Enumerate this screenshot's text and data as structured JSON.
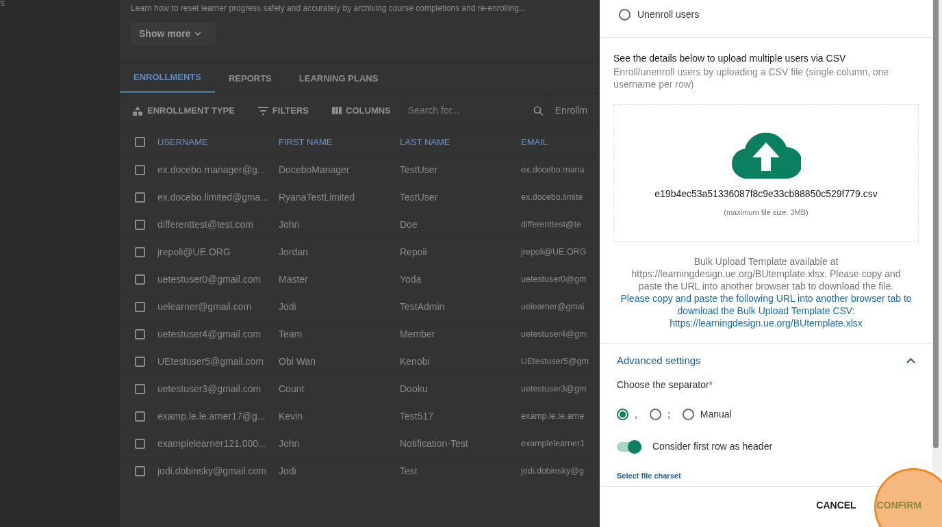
{
  "sidebar": {
    "fragment": "s"
  },
  "course": {
    "description": "Learn how to reset learner progress safely and accurately by archiving course completions and re-enrolling...",
    "show_more": "Show more"
  },
  "tabs": [
    {
      "label": "ENROLLMENTS",
      "selected": true
    },
    {
      "label": "REPORTS",
      "selected": false
    },
    {
      "label": "LEARNING PLANS",
      "selected": false
    }
  ],
  "toolbar": {
    "enrollment_type": "ENROLLMENT TYPE",
    "filters": "FILTERS",
    "columns": "COLUMNS",
    "search_placeholder": "Search for...",
    "dropdown": "Enrollm"
  },
  "table": {
    "all_checked": false,
    "columns": [
      "USERNAME",
      "FIRST NAME",
      "LAST NAME",
      "EMAIL"
    ],
    "rows": [
      {
        "checked": false,
        "cells": [
          "ex.docebo.manager@g...",
          "DoceboManager",
          "TestUser",
          "ex.docebo.mana"
        ]
      },
      {
        "checked": false,
        "cells": [
          "ex.docebo.limited@gma...",
          "RyanaTestLimited",
          "TestUser",
          "ex.docebo.limite"
        ]
      },
      {
        "checked": false,
        "cells": [
          "differenttest@test.com",
          "John",
          "Doe",
          "differenttest@te"
        ]
      },
      {
        "checked": false,
        "cells": [
          "jrepoli@UE.ORG",
          "Jordan",
          "Repoli",
          "jrepoli@UE.ORG"
        ]
      },
      {
        "checked": false,
        "cells": [
          "uetestuser0@gmail.com",
          "Master",
          "Yoda",
          "uetestuser0@gm"
        ]
      },
      {
        "checked": false,
        "cells": [
          "uelearner@gmail.com",
          "Jodi",
          "TestAdmin",
          "uelearner@gmai"
        ]
      },
      {
        "checked": false,
        "cells": [
          "uetestuser4@gmail.com",
          "Team",
          "Member",
          "uetestuser4@gm"
        ]
      },
      {
        "checked": false,
        "cells": [
          "UEtestuser5@gmail.com",
          "Obi Wan",
          "Kenobi",
          "UEtestuser5@gm"
        ]
      },
      {
        "checked": false,
        "cells": [
          "uetestuser3@gmail.com",
          "Count",
          "Dooku",
          "uetestuser3@gm"
        ]
      },
      {
        "checked": false,
        "cells": [
          "examp.le.le.arner17@g...",
          "Kevin",
          "Test517",
          "examp.le.le.arne"
        ]
      },
      {
        "checked": false,
        "cells": [
          "examplelearner121.000...",
          "John",
          "Notification-Test",
          "examplelearner1"
        ]
      },
      {
        "checked": false,
        "cells": [
          "jodi.dobinsky@gmail.com",
          "Jodi",
          "Test",
          "jodi.dobinsky@g"
        ]
      }
    ]
  },
  "drawer": {
    "unenroll": {
      "label": "Unenroll users",
      "selected": false
    },
    "csv_title": "See the details below to upload multiple users via CSV",
    "csv_description": "Enroll/unenroll users by uploading a CSV file (single column, one username per row)",
    "file_name": "e19b4ec53a51336087f8c9e33cb88850c529f779.csv",
    "max_size": "(maximum file size: 3MB)",
    "template_note": "Bulk Upload Template available at https://learningdesign.ue.org/BUtemplate.xlsx. Please copy and paste the URL into another browser tab to download the file.",
    "template_link": "Please copy and paste the following URL into another browser tab to download the Bulk Upload Template CSV: https://learningdesign.ue.org/BUtemplate.xlsx",
    "advanced": {
      "title": "Advanced settings",
      "expanded": true,
      "separator_label": "Choose the separator",
      "required_mark": "*",
      "separators": [
        {
          "label": ",",
          "selected": true
        },
        {
          "label": ";",
          "selected": false
        },
        {
          "label": "Manual",
          "selected": false
        }
      ],
      "header_toggle": {
        "label": "Consider first row as header",
        "on": true
      },
      "charset_link": "Select file charset"
    },
    "buttons": {
      "cancel": "CANCEL",
      "confirm": "CONFIRM"
    },
    "highlight": {
      "on": true
    }
  }
}
